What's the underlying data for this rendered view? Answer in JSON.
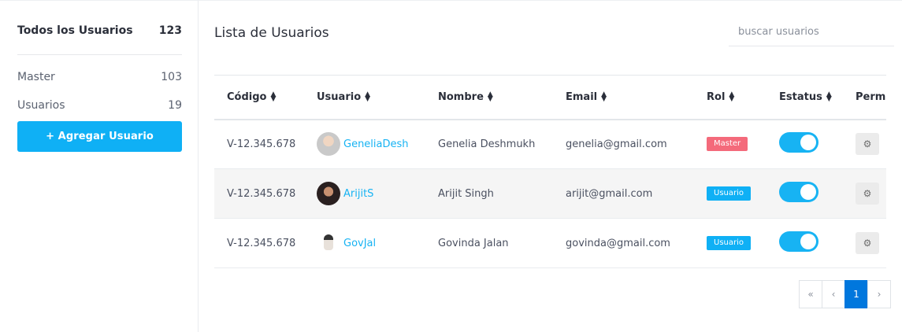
{
  "sidebar": {
    "all_label": "Todos los Usuarios",
    "all_count": "123",
    "items": [
      {
        "label": "Master",
        "count": "103"
      },
      {
        "label": "Usuarios",
        "count": "19"
      }
    ],
    "add_button": "+ Agregar Usuario"
  },
  "main": {
    "title": "Lista de Usuarios",
    "search_placeholder": "buscar usuarios"
  },
  "table": {
    "headers": [
      "Código",
      "Usuario",
      "Nombre",
      "Email",
      "Rol",
      "Estatus",
      "Permi"
    ],
    "rows": [
      {
        "codigo": "V-12.345.678",
        "usuario": "GeneliaDesh",
        "nombre": "Genelia Deshmukh",
        "email": "genelia@gmail.com",
        "rol": "Master",
        "rol_type": "master",
        "estatus": true
      },
      {
        "codigo": "V-12.345.678",
        "usuario": "ArijitS",
        "nombre": "Arijit Singh",
        "email": "arijit@gmail.com",
        "rol": "Usuario",
        "rol_type": "usuario",
        "estatus": true
      },
      {
        "codigo": "V-12.345.678",
        "usuario": "GovJal",
        "nombre": "Govinda Jalan",
        "email": "govinda@gmail.com",
        "rol": "Usuario",
        "rol_type": "usuario",
        "estatus": true
      }
    ]
  },
  "pagination": {
    "first": "«",
    "prev": "‹",
    "current": "1",
    "next": "›"
  },
  "colors": {
    "accent": "#0fb0f5",
    "master_badge": "#f46a7b",
    "active_page": "#0077dd"
  }
}
